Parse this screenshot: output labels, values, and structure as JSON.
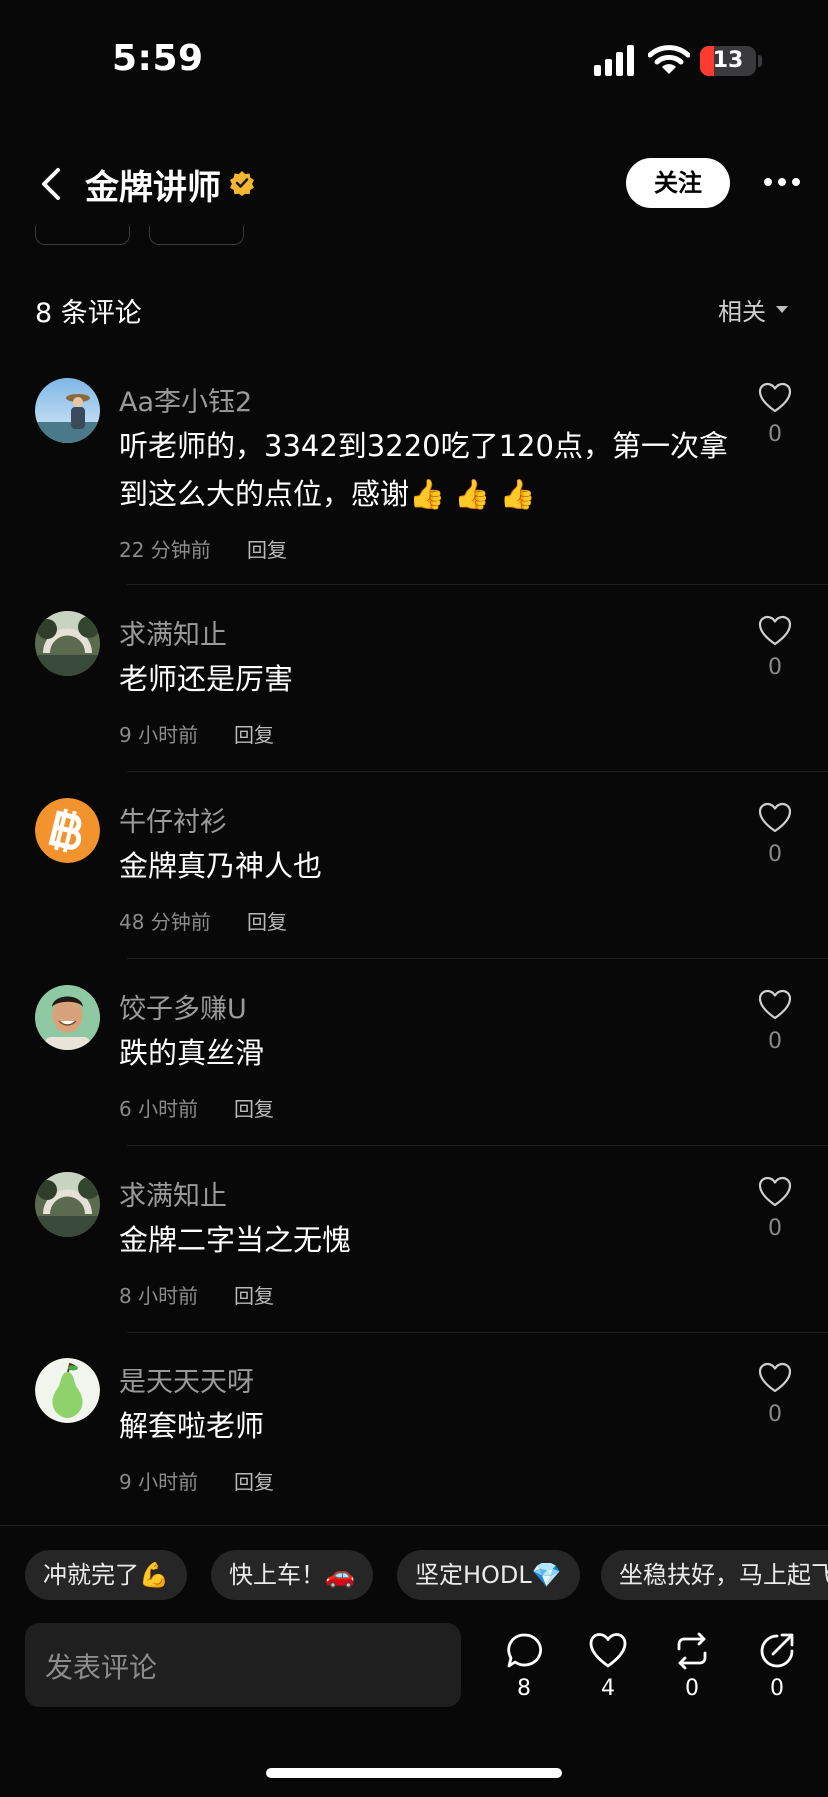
{
  "status_bar": {
    "time": "5:59",
    "battery": "13"
  },
  "header": {
    "title": "金牌讲师",
    "follow_label": "关注"
  },
  "comments_header": {
    "count_label": "8 条评论",
    "sort_label": "相关"
  },
  "comments": [
    {
      "user": "Aa李小钰2",
      "text": "听老师的，3342到3220吃了120点，第一次拿到这么大的点位，感谢👍 👍 👍",
      "time": "22 分钟前",
      "reply": "回复",
      "likes": "0"
    },
    {
      "user": "求满知止",
      "text": "老师还是厉害",
      "time": "9 小时前",
      "reply": "回复",
      "likes": "0"
    },
    {
      "user": "牛仔衬衫",
      "text": "金牌真乃神人也",
      "time": "48 分钟前",
      "reply": "回复",
      "likes": "0"
    },
    {
      "user": "饺子多赚U",
      "text": "跌的真丝滑",
      "time": "6 小时前",
      "reply": "回复",
      "likes": "0"
    },
    {
      "user": "求满知止",
      "text": "金牌二字当之无愧",
      "time": "8 小时前",
      "reply": "回复",
      "likes": "0"
    },
    {
      "user": "是天天天呀",
      "text": "解套啦老师",
      "time": "9 小时前",
      "reply": "回复",
      "likes": "0"
    }
  ],
  "quick_replies": [
    "冲就完了💪",
    "快上车！🚗",
    "坚定HODL💎",
    "坐稳扶好，马上起飞"
  ],
  "composer": {
    "placeholder": "发表评论"
  },
  "actions": {
    "comments": "8",
    "likes": "4",
    "reposts": "0",
    "shares": "0"
  },
  "icons": [
    "chevron-left-icon",
    "verified-icon",
    "more-icon",
    "heart-icon",
    "comment-icon",
    "repost-icon",
    "share-icon",
    "signal-icon",
    "wifi-icon",
    "battery-icon"
  ]
}
